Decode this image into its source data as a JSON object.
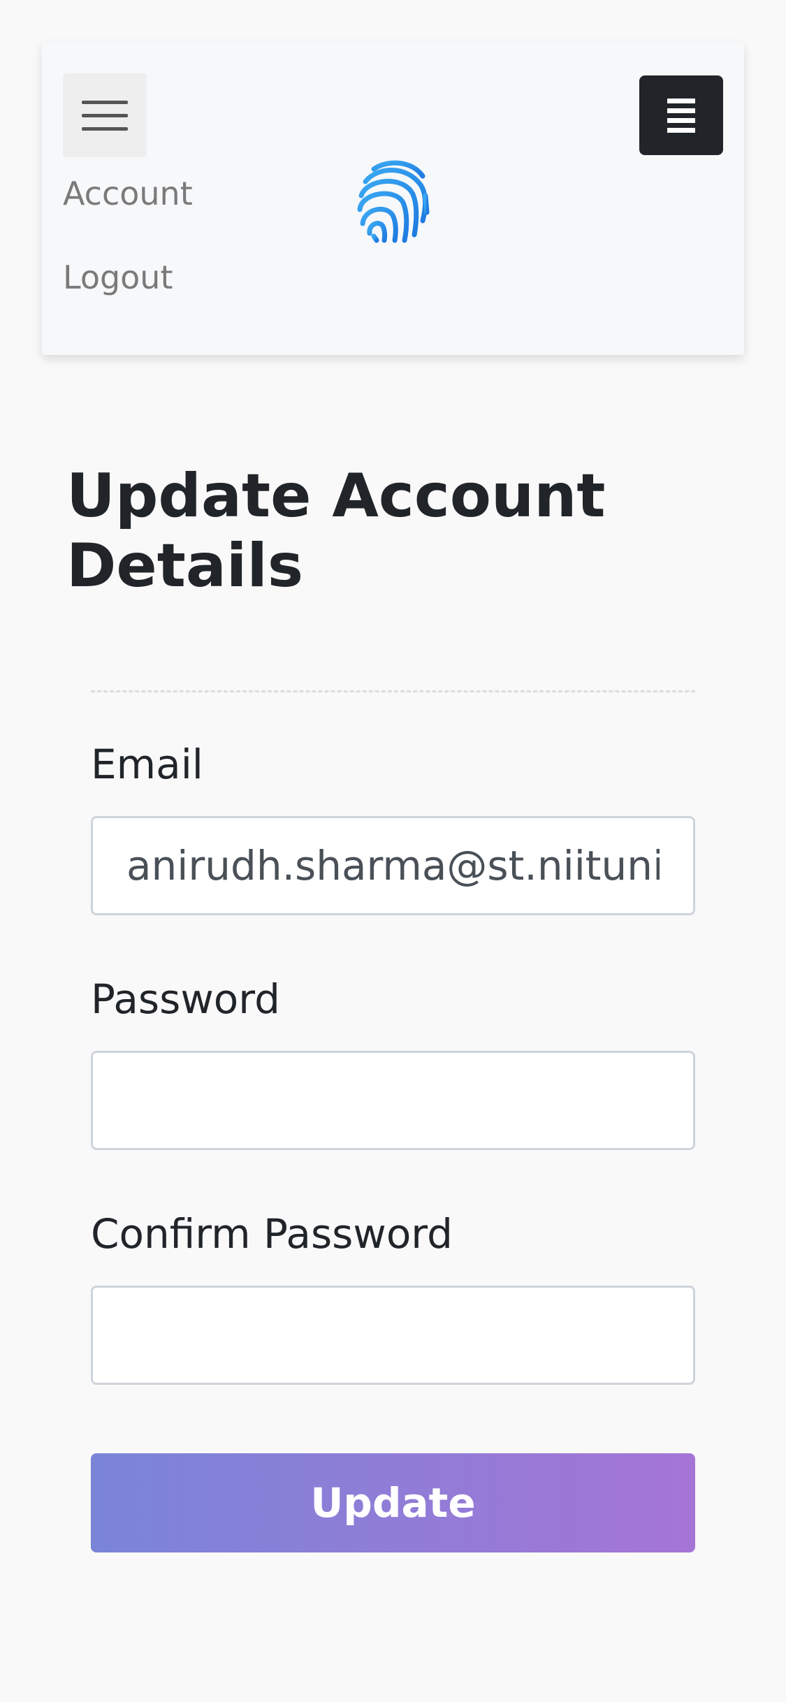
{
  "navbar": {
    "links": {
      "account": "Account",
      "logout": "Logout"
    },
    "logo_icon": "fingerprint-icon",
    "logo_colors": [
      "#3aa8f2",
      "#1e7be0"
    ],
    "toggler_icon": "hamburger-menu-icon",
    "right_button_icon": "menu-lines-icon"
  },
  "page": {
    "title": "Update Account Details"
  },
  "form": {
    "email": {
      "label": "Email",
      "value": "anirudh.sharma@st.niituniversity.in",
      "placeholder": ""
    },
    "password": {
      "label": "Password",
      "value": "",
      "placeholder": ""
    },
    "confirm_password": {
      "label": "Confirm Password",
      "value": "",
      "placeholder": ""
    },
    "submit_label": "Update",
    "submit_gradient": [
      "#7a85d8",
      "#a575d6"
    ]
  }
}
